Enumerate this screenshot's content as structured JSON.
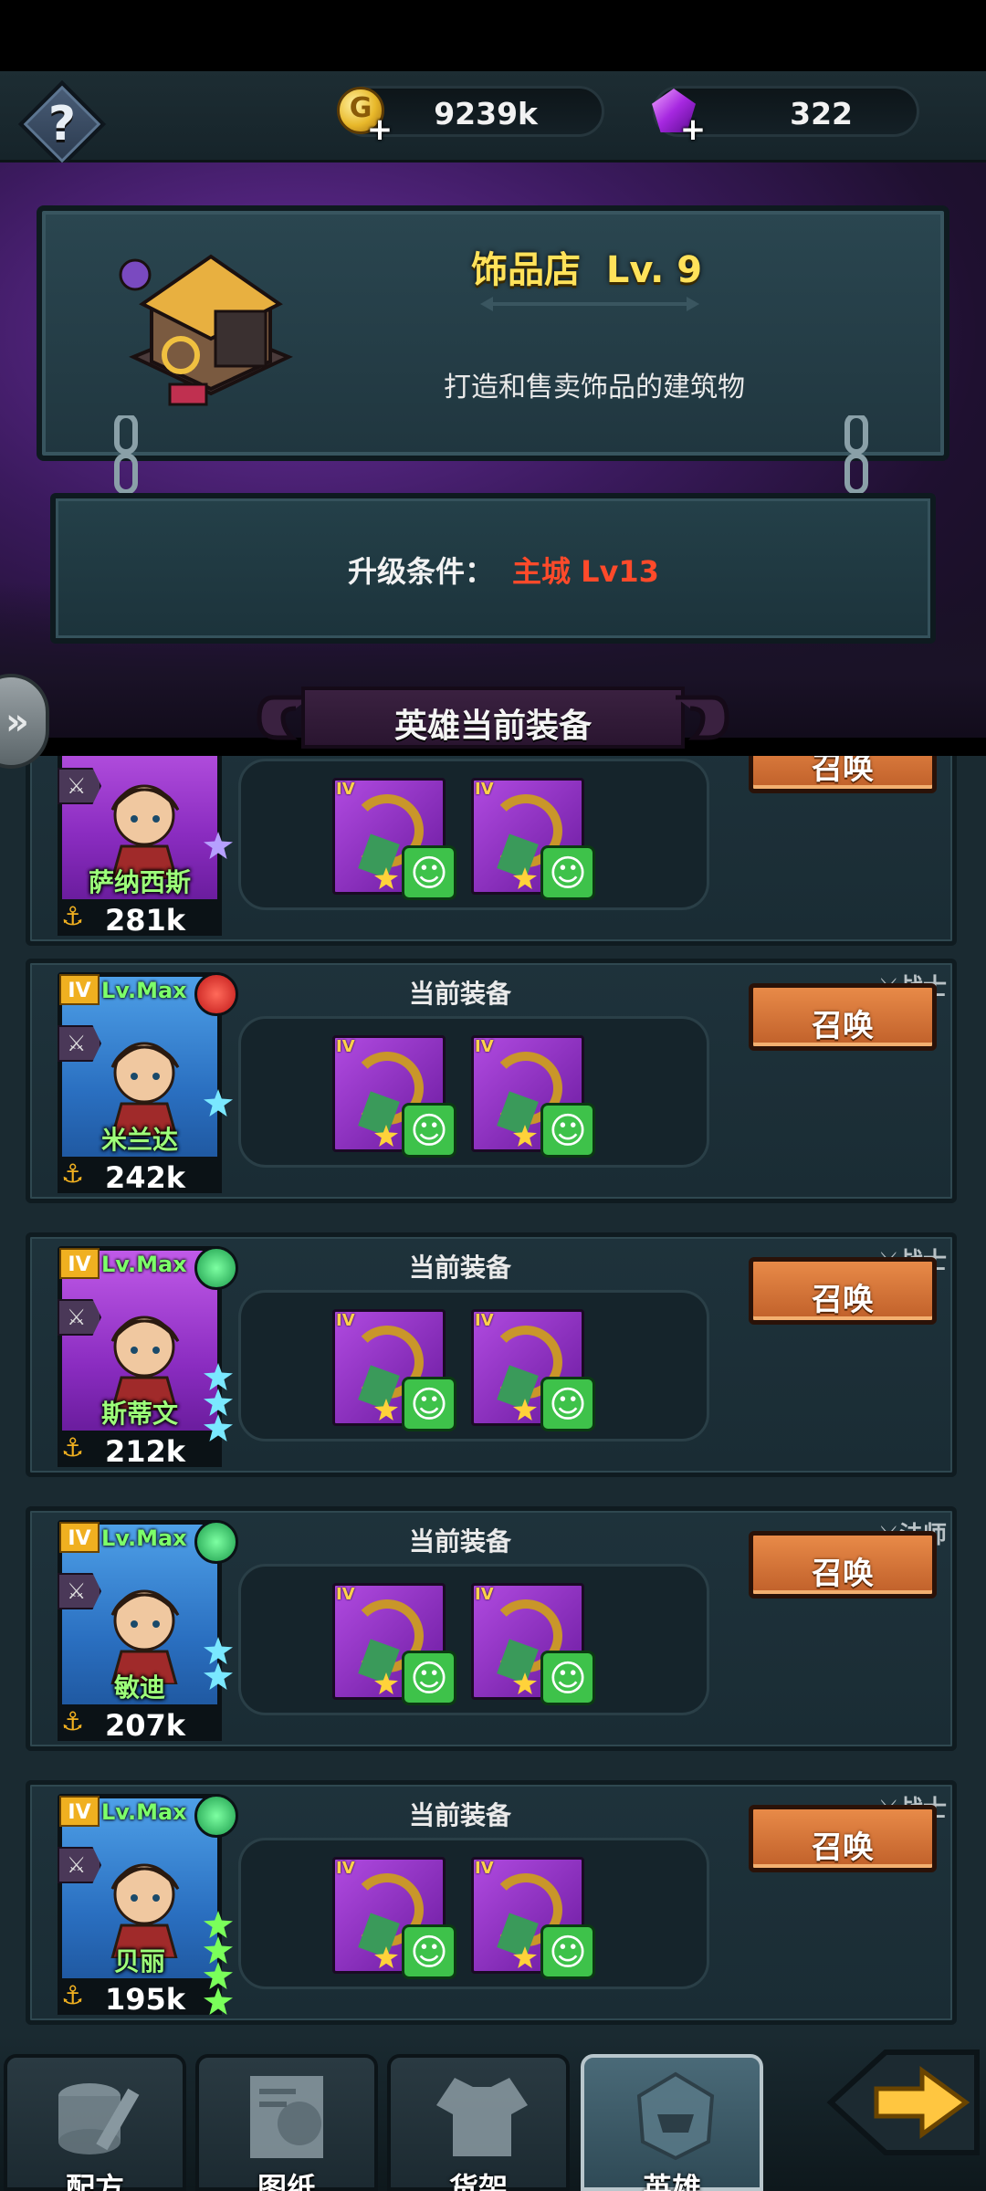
{
  "currencies": {
    "gold": "9239k",
    "gems": "322"
  },
  "building": {
    "name": "饰品店",
    "level": "Lv. 9",
    "description": "打造和售卖饰品的建筑物",
    "upgrade_label": "升级条件：",
    "upgrade_requirement": "主城 Lv13"
  },
  "section_title": "英雄当前装备",
  "current_equip_label": "当前装备",
  "summon_label": "召唤",
  "heroes": [
    {
      "name": "萨纳西斯",
      "power": "281k",
      "tier": "IV",
      "class": "",
      "frame": "purple",
      "star_color": "violet",
      "stars": 1
    },
    {
      "name": "米兰达",
      "power": "242k",
      "tier": "IV",
      "level": "Lv.Max",
      "element": "fire",
      "class": "战士",
      "frame": "blue",
      "star_color": "cyan",
      "stars": 1
    },
    {
      "name": "斯蒂文",
      "power": "212k",
      "tier": "IV",
      "level": "Lv.Max",
      "element": "wind",
      "class": "战士",
      "frame": "purple",
      "star_color": "cyan",
      "stars": 3
    },
    {
      "name": "敏迪",
      "power": "207k",
      "tier": "IV",
      "level": "Lv.Max",
      "element": "wind",
      "class": "法师",
      "frame": "blue",
      "star_color": "cyan",
      "stars": 2
    },
    {
      "name": "贝丽",
      "power": "195k",
      "tier": "IV",
      "level": "Lv.Max",
      "element": "wind",
      "class": "战士",
      "frame": "blue",
      "star_color": "green",
      "stars": 4
    }
  ],
  "equip_tier": "IV",
  "bottom_nav": {
    "tabs": [
      "配方",
      "图纸",
      "货架",
      "英雄"
    ],
    "active": "英雄"
  },
  "colors": {
    "accent_gold": "#ffe25a",
    "requirement_red": "#ff4a2a",
    "summon_orange": "#e88a48",
    "hero_name_green": "#9dff7a"
  }
}
